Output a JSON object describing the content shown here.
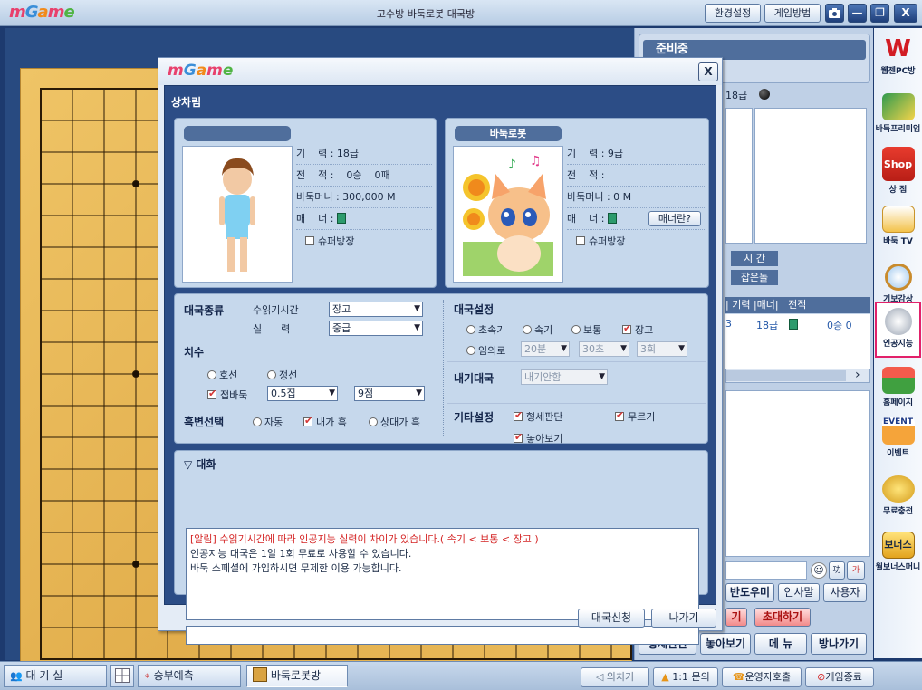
{
  "window": {
    "logo": [
      "m",
      "G",
      "a",
      "m",
      "e"
    ],
    "title": "고수방 바둑로봇 대국방",
    "settings_label": "환경설정",
    "howto_label": "게임방법",
    "camera_icon": "camera-icon",
    "min_label": "—",
    "max_label": "❐",
    "close_label": "X"
  },
  "right_panel": {
    "status": "준비중",
    "rank": "18급",
    "time_label": "시  간",
    "captured_label": "잡은돌",
    "table_header": "| 기력 |매너|   전적",
    "table_row": {
      "prefix": "3",
      "rank": "18급",
      "record": "0승 0"
    },
    "scroll_right": "›",
    "chat_emoji1": "功",
    "chat_emoji2": "가",
    "bandomi": "반도우미",
    "greeting": "인사말",
    "user": "사용자",
    "fragment": "기",
    "invite": "초대하기",
    "judge": "형세판단",
    "let_see": "놓아보기",
    "menu": "메 뉴",
    "exit": "방나가기"
  },
  "sidebar": [
    {
      "label": "웹젠PC방",
      "icon": "webzen-icon"
    },
    {
      "label": "바둑프리미엄",
      "icon": "premium-icon"
    },
    {
      "label": "상 점",
      "icon": "shop-icon"
    },
    {
      "label": "바둑 TV",
      "icon": "tv-icon"
    },
    {
      "label": "기보감상",
      "icon": "magnifier-icon"
    },
    {
      "label": "인공지능",
      "icon": "ai-icon"
    },
    {
      "label": "홈페이지",
      "icon": "home-icon"
    },
    {
      "label": "이벤트",
      "icon": "event-icon"
    },
    {
      "label": "무료충전",
      "icon": "coins-icon"
    },
    {
      "label": "월보너스머니",
      "icon": "bonus-icon"
    }
  ],
  "sidebar_extra": {
    "shop_text": "Shop",
    "event_text": "EVENT",
    "bonus_text": "보너스"
  },
  "bottom": {
    "lobby": "대 기 실",
    "predict": "승부예측",
    "robot_room": "바둑로봇방",
    "shout": "외치기",
    "inquiry": "1:1 문의",
    "operator": "운영자호출",
    "quit": "게임종료"
  },
  "dialog": {
    "logo": [
      "m",
      "G",
      "a",
      "m",
      "e"
    ],
    "close": "X",
    "heading": "상차림",
    "player1": {
      "name": "",
      "rank": "기    력 : 18급",
      "record": "전    적 :    0승    0패",
      "money": "바둑머니 : 300,000 M",
      "manner_label": "매    너 : ",
      "super": "슈퍼방장"
    },
    "player2": {
      "name": "바둑로봇",
      "rank": "기    력 : 9급",
      "record": "전    적 : ",
      "money": "바둑머니 : 0 M",
      "manner_label": "매    너 : ",
      "manner_btn": "매너란?",
      "super": "슈퍼방장"
    },
    "game_type": {
      "label": "대국종류",
      "think_label": "수읽기시간",
      "think_value": "장고",
      "skill_label": "실      력",
      "skill_value": "중급"
    },
    "handicap": {
      "label": "치수",
      "opt1": "호선",
      "opt2": "정선",
      "opt3": "접바둑",
      "komi": "0.5집",
      "stones": "9점"
    },
    "color": {
      "label": "흑변선택",
      "opt1": "자동",
      "opt2": "내가 흑",
      "opt3": "상대가 흑"
    },
    "settings": {
      "label": "대국설정",
      "opt1": "초속기",
      "opt2": "속기",
      "opt3": "보통",
      "opt4": "장고",
      "opt5": "임의로",
      "sel1": "20분",
      "sel2": "30초",
      "sel3": "3회"
    },
    "bet": {
      "label": "내기대국",
      "value": "내기안함"
    },
    "other": {
      "label": "기타설정",
      "opt1": "형세판단",
      "opt2": "무르기",
      "opt3": "놓아보기"
    },
    "chat": {
      "label": "▽ 대화",
      "line1": "[알림] 수읽기시간에 따라 인공지능 실력이 차이가 있습니다.( 속기 < 보통 < 장고 )",
      "line2": "인공지능 대국은 1일 1회 무료로 사용할 수 있습니다.",
      "line3": "바둑 스페셜에 가입하시면 무제한 이용 가능합니다."
    },
    "apply": "대국신청",
    "leave": "나가기"
  },
  "colors": {
    "accent": "#2c4d86",
    "alert": "#d42424",
    "highlight": "#e2216a",
    "manner": "#2c9b6c"
  }
}
